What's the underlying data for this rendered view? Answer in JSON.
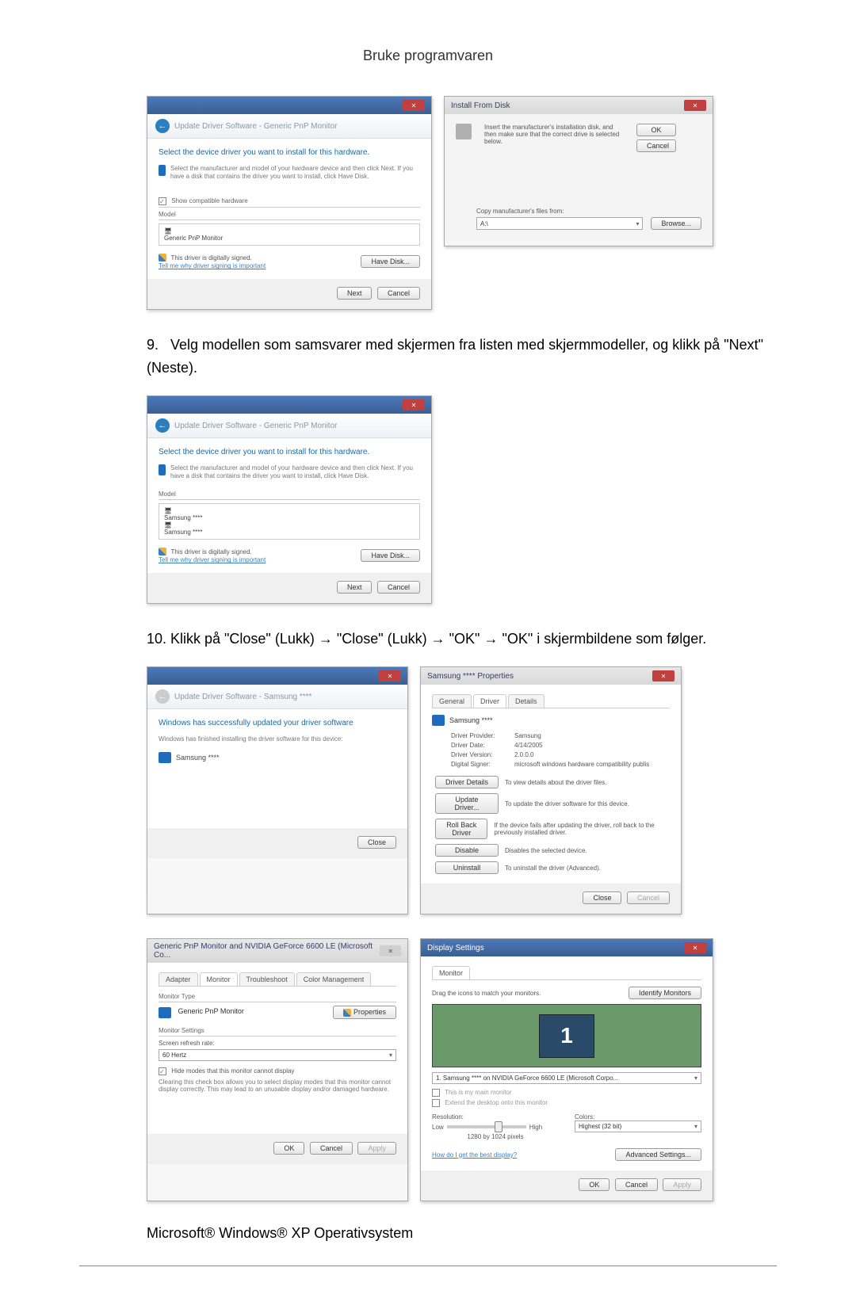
{
  "page_header": "Bruke programvaren",
  "step9_text": "Velg modellen som samsvarer med skjermen fra listen med skjermmodeller, og klikk på \"Next\" (Neste).",
  "step9_num": "9.",
  "step10_text": "Klikk på \"Close\" (Lukk) → \"Close\" (Lukk) → \"OK\" → \"OK\" i skjermbildene som følger.",
  "step10_num": "10.",
  "os_text": "Microsoft® Windows® XP Operativsystem",
  "dlg_select1": {
    "breadcrumb": "Update Driver Software - Generic PnP Monitor",
    "heading": "Select the device driver you want to install for this hardware.",
    "subtext": "Select the manufacturer and model of your hardware device and then click Next. If you have a disk that contains the driver you want to install, click Have Disk.",
    "compat_label": "Show compatible hardware",
    "model_label": "Model",
    "model_item": "Generic PnP Monitor",
    "signed": "This driver is digitally signed.",
    "signed_link": "Tell me why driver signing is important",
    "have_disk": "Have Disk...",
    "next": "Next",
    "cancel": "Cancel"
  },
  "dlg_install": {
    "title": "Install From Disk",
    "text": "Insert the manufacturer's installation disk, and then make sure that the correct drive is selected below.",
    "ok": "OK",
    "cancel": "Cancel",
    "copy_label": "Copy manufacturer's files from:",
    "copy_value": "A:\\",
    "browse": "Browse..."
  },
  "dlg_select2": {
    "breadcrumb": "Update Driver Software - Generic PnP Monitor",
    "heading": "Select the device driver you want to install for this hardware.",
    "subtext": "Select the manufacturer and model of your hardware device and then click Next. If you have a disk that contains the driver you want to install, click Have Disk.",
    "model_label": "Model",
    "model_item1": "Samsung ****",
    "model_item2": "Samsung ****",
    "signed": "This driver is digitally signed.",
    "signed_link": "Tell me why driver signing is important",
    "have_disk": "Have Disk...",
    "next": "Next",
    "cancel": "Cancel"
  },
  "dlg_updated": {
    "breadcrumb": "Update Driver Software - Samsung ****",
    "heading": "Windows has successfully updated your driver software",
    "subtext": "Windows has finished installing the driver software for this device:",
    "model": "Samsung ****",
    "close": "Close"
  },
  "dlg_props": {
    "title": "Samsung **** Properties",
    "tabs": [
      "General",
      "Driver",
      "Details"
    ],
    "device": "Samsung ****",
    "rows": {
      "provider_l": "Driver Provider:",
      "provider_v": "Samsung",
      "date_l": "Driver Date:",
      "date_v": "4/14/2005",
      "version_l": "Driver Version:",
      "version_v": "2.0.0.0",
      "signer_l": "Digital Signer:",
      "signer_v": "microsoft windows hardware compatibility publis"
    },
    "btn_details": "Driver Details",
    "txt_details": "To view details about the driver files.",
    "btn_update": "Update Driver...",
    "txt_update": "To update the driver software for this device.",
    "btn_rollback": "Roll Back Driver",
    "txt_rollback": "If the device fails after updating the driver, roll back to the previously installed driver.",
    "btn_disable": "Disable",
    "txt_disable": "Disables the selected device.",
    "btn_uninstall": "Uninstall",
    "txt_uninstall": "To uninstall the driver (Advanced).",
    "close": "Close",
    "cancel": "Cancel"
  },
  "dlg_monitor": {
    "title": "Generic PnP Monitor and NVIDIA GeForce 6600 LE (Microsoft Co...",
    "tabs": [
      "Adapter",
      "Monitor",
      "Troubleshoot",
      "Color Management"
    ],
    "type_label": "Monitor Type",
    "type_value": "Generic PnP Monitor",
    "properties": "Properties",
    "settings_label": "Monitor Settings",
    "refresh_label": "Screen refresh rate:",
    "refresh_value": "60 Hertz",
    "hide_check": "Hide modes that this monitor cannot display",
    "hide_text": "Clearing this check box allows you to select display modes that this monitor cannot display correctly. This may lead to an unusable display and/or damaged hardware.",
    "ok": "OK",
    "cancel": "Cancel",
    "apply": "Apply"
  },
  "dlg_display": {
    "title": "Display Settings",
    "tab": "Monitor",
    "drag_text": "Drag the icons to match your monitors.",
    "identify": "Identify Monitors",
    "monitor_num": "1",
    "dropdown": "1. Samsung **** on NVIDIA GeForce 6600 LE (Microsoft Corpo...",
    "main_check": "This is my main monitor",
    "extend_check": "Extend the desktop onto this monitor",
    "res_label": "Resolution:",
    "res_low": "Low",
    "res_high": "High",
    "res_value": "1280 by 1024 pixels",
    "colors_label": "Colors:",
    "colors_value": "Highest (32 bit)",
    "help_link": "How do I get the best display?",
    "advanced": "Advanced Settings...",
    "ok": "OK",
    "cancel": "Cancel",
    "apply": "Apply"
  }
}
